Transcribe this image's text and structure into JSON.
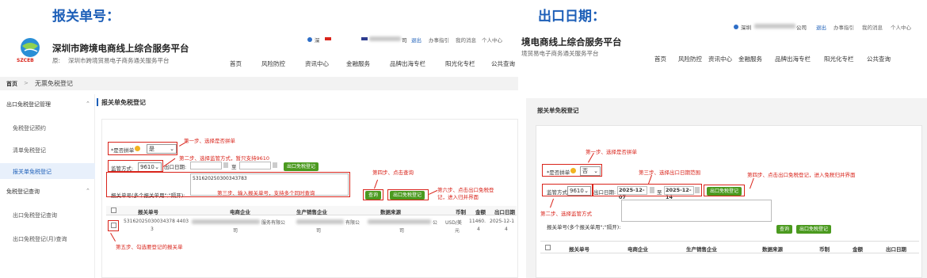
{
  "left": {
    "section_title": "报关单号：",
    "site_title": "深圳市跨境电商线上综合服务平台",
    "site_subtitle": "深圳市跨境贸易电子商务通关服务平台",
    "logo_text": "SZCEB",
    "logo_prefix": "原:",
    "topbar": {
      "user": "深",
      "company": "司",
      "logout": "退出",
      "guide": "办事指引",
      "messages": "我的消息",
      "personal": "个人中心"
    },
    "nav": [
      "首页",
      "风险防控",
      "资讯中心",
      "金融服务",
      "品牌出海专栏",
      "阳光化专栏",
      "公共查询"
    ],
    "breadcrumb": {
      "home": "首页",
      "sep": ">",
      "current": "无票免税登记"
    },
    "sidebar": {
      "group1": "出口免税登记管理",
      "items1": [
        "免税登记预约",
        "清单免税登记",
        "报关单免税登记"
      ],
      "group2": "免税登记查询",
      "items2": [
        "出口免税登记查询",
        "出口免税登记(月)查询"
      ]
    },
    "panel_title": "报关单免税登记",
    "form": {
      "summary_label": "*是否拼单",
      "summary_value": "是",
      "mode_label": "监管方式:",
      "mode_value": "9610",
      "date_label": "出口日期:",
      "date_sep": "至",
      "btn_register": "出口免税登记",
      "numbers_label": "报关单号(多个报关单用\";\"隔开):",
      "numbers_value": "531620250300343783",
      "btn_query": "查询",
      "btn_register2": "出口免税登记"
    },
    "annotations": {
      "step1": "第一步、选择是否拼单",
      "step2": "第二步、选择监管方式，暂只支持9610",
      "step3": "第三步、输入报关单号，支持多个同时查询",
      "step4": "第四步、点击查询",
      "step5": "第五步、勾选要登记的报关单",
      "step6": "第六步、点击出口免税登记，进入归并界面"
    },
    "table": {
      "headers": [
        "报关单号",
        "电商企业",
        "生产销售企业",
        "数据来源",
        "币制",
        "金额",
        "出口日期"
      ],
      "row": {
        "number": "53162025030034378 4403",
        "number_cont": "3",
        "ecom_tail": "服务有限公",
        "ecom_tail2": "司",
        "prod_tail": "有限公",
        "prod_tail2": "司",
        "source_tail": "公",
        "source_tail2": "司",
        "currency": "USD/美",
        "currency2": "元",
        "amount": "11460.",
        "amount2": "4",
        "date": "2025-12-1",
        "date2": "4"
      }
    }
  },
  "right": {
    "section_title": "出口日期：",
    "site_title": "境电商线上综合服务平台",
    "site_subtitle": "境贸易电子商务通关服务平台",
    "topbar": {
      "user": "深圳",
      "company": "公司",
      "logout": "退出",
      "guide": "办事指引",
      "messages": "我的消息",
      "personal": "个人中心"
    },
    "nav": [
      "首页",
      "风险防控",
      "资讯中心",
      "金融服务",
      "品牌出海专栏",
      "阳光化专栏",
      "公共查询"
    ],
    "panel_title": "报关单免税登记",
    "form": {
      "summary_label": "*是否拼单",
      "summary_value": "否",
      "mode_label": "监管方式:",
      "mode_value": "9610",
      "date_label": "出口日期:",
      "date_from": "2025-12-07",
      "date_sep": "至",
      "date_to": "2025-12-14",
      "btn_register": "出口免税登记",
      "numbers_label": "报关单号(多个报关单用\";\"隔开):",
      "btn_query": "查询",
      "btn_register2": "出口免税登记"
    },
    "annotations": {
      "step1": "第一步、选择是否拼单",
      "step2": "第二步、选择监管方式",
      "step3": "第三步、选择出口日期范围",
      "step4": "第四步、点击出口免税登记，进入免税归并界面"
    },
    "table": {
      "headers": [
        "报关单号",
        "电商企业",
        "生产销售企业",
        "数据来源",
        "币制",
        "金额",
        "出口日期"
      ]
    }
  }
}
